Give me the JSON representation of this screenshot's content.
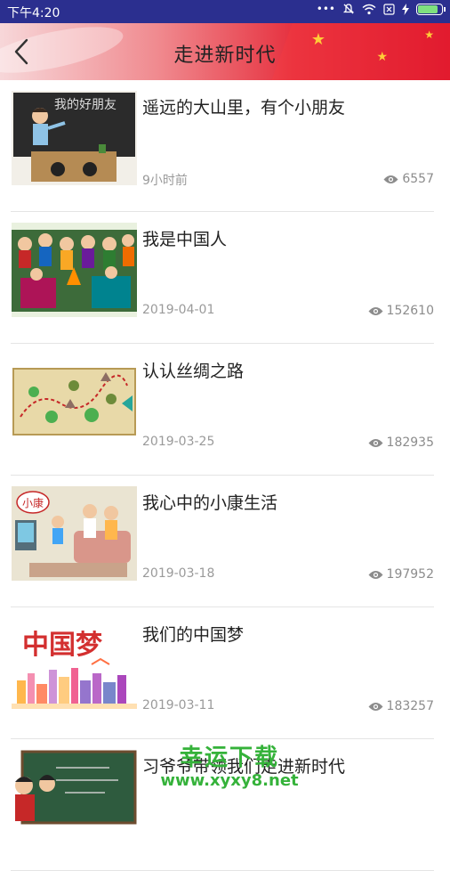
{
  "status_bar": {
    "time": "下午4:20",
    "dots": "•••"
  },
  "header": {
    "title": "走进新时代",
    "back_icon": "chevron-left-icon"
  },
  "articles": [
    {
      "title": "遥远的大山里，有个小朋友",
      "date": "9小时前",
      "views": "6557",
      "thumb_text": "我的好朋友"
    },
    {
      "title": "我是中国人",
      "date": "2019-04-01",
      "views": "152610"
    },
    {
      "title": "认认丝绸之路",
      "date": "2019-03-25",
      "views": "182935"
    },
    {
      "title": "我心中的小康生活",
      "date": "2019-03-18",
      "views": "197952",
      "thumb_text": "小康"
    },
    {
      "title": "我们的中国梦",
      "date": "2019-03-11",
      "views": "183257",
      "thumb_text": "中国梦"
    },
    {
      "title": "习爷爷带领我们走进新时代",
      "date": "",
      "views": ""
    }
  ],
  "watermark": {
    "line1": "幸运下载",
    "line2": "www.xyxy8.net"
  },
  "colors": {
    "status_bar": "#2b2f8f",
    "header_red": "#d8102a",
    "watermark_green": "#35b23a"
  }
}
